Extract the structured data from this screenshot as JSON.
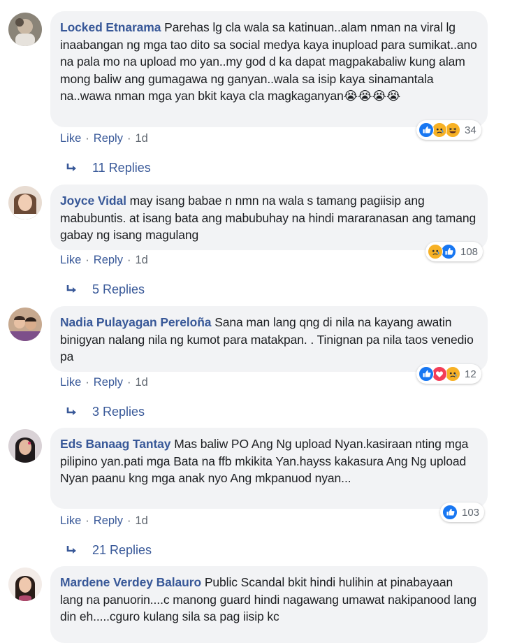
{
  "comments": [
    {
      "author": "Locked Etnarama",
      "text": "Parehas lg cla wala sa katinuan..alam nman na viral lg inaabangan ng mga tao dito sa social medya kaya inupload para sumikat..ano na pala mo na upload mo yan..my god d ka dapat magpakabaliw kung alam mong baliw ang gumagawa ng ganyan..wala sa isip kaya sinamantala na..wawa nman mga yan bkit kaya cla magkaganyan😭😭😭😭",
      "reactions": [
        "like-icon",
        "sad-icon",
        "haha-icon"
      ],
      "reaction_count": "34",
      "like_label": "Like",
      "reply_label": "Reply",
      "time": "1d",
      "replies_label": "11 Replies"
    },
    {
      "author": "Joyce Vidal",
      "text": "may isang babae n nmn na wala s tamang pagiisip ang mabubuntis. at isang bata ang mabubuhay na hindi mararanasan ang tamang gabay ng isang magulang",
      "reactions": [
        "sad-icon",
        "like-icon"
      ],
      "reaction_count": "108",
      "like_label": "Like",
      "reply_label": "Reply",
      "time": "1d",
      "replies_label": "5 Replies"
    },
    {
      "author": "Nadia Pulayagan Pereloña",
      "text": "Sana man lang qng di nila na kayang awatin binigyan nalang nila ng kumot para matakpan. . Tinignan pa nila taos venedio pa",
      "reactions": [
        "like-icon",
        "love-icon",
        "sad-icon"
      ],
      "reaction_count": "12",
      "like_label": "Like",
      "reply_label": "Reply",
      "time": "1d",
      "replies_label": "3 Replies"
    },
    {
      "author": "Eds Banaag Tantay",
      "text": "Mas baliw PO Ang Ng upload Nyan.kasiraan nting mga pilipino yan.pati mga Bata na ffb mkikita Yan.hayss kakasura Ang Ng upload Nyan paanu kng mga anak nyo Ang mkpanuod nyan...",
      "reactions": [
        "like-icon"
      ],
      "reaction_count": "103",
      "like_label": "Like",
      "reply_label": "Reply",
      "time": "1d",
      "replies_label": "21 Replies"
    },
    {
      "author": "Mardene Verdey Balauro",
      "text": "Public Scandal bkit hindi hulihin at pinabayaan lang na panuorin....c manong guard hindi nagawang umawat nakipanood lang din eh.....cguro kulang sila sa pag iisip kc",
      "reactions": [],
      "reaction_count": "",
      "like_label": "",
      "reply_label": "",
      "time": "",
      "replies_label": ""
    }
  ],
  "colors": {
    "author": "#385898",
    "bubble": "#f2f3f5",
    "like": "#1877f2",
    "love": "#f33e58",
    "emoji": "#f7b125"
  }
}
